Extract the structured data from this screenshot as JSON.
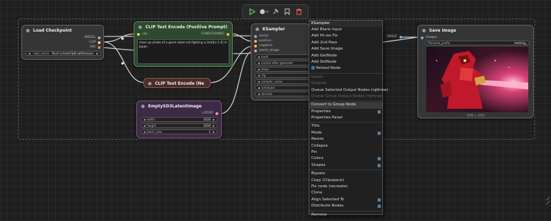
{
  "toolbar": {
    "items": [
      "run",
      "queue-options",
      "pin",
      "bookmark",
      "delete"
    ]
  },
  "nodes": {
    "load_checkpoint": {
      "title": "Load Checkpoint",
      "outputs": [
        "MODEL",
        "CLIP",
        "VAE"
      ],
      "ckpt_label": "ckpt_name",
      "ckpt_value": "flux1-schnell-fp8.safetensors"
    },
    "clip_pos": {
      "title": "CLIP Text Encode (Positive Prompt)",
      "input": "clip",
      "output": "CONDITIONING",
      "prompt": "close up photo of a giant robot red fighting a (hat)[x:1.4] in Japan"
    },
    "clip_neg": {
      "title": "CLIP Text Encode (Ne"
    },
    "ksampler": {
      "title": "KSampler",
      "inputs": [
        "model",
        "positive",
        "negative",
        "latent_image"
      ],
      "widgets": [
        "seed",
        "control after generate",
        "steps",
        "cfg",
        "sampler_name",
        "scheduler",
        "denoise"
      ]
    },
    "empty_latent": {
      "title": "EmptySD3LatentImage",
      "output": "LATENT",
      "widgets": [
        {
          "label": "width",
          "value": "1024"
        },
        {
          "label": "height",
          "value": "1024"
        },
        {
          "label": "batch_size",
          "value": "1"
        }
      ]
    },
    "save_image": {
      "title": "Save Image",
      "input": "images",
      "prefix_label": "filename_prefix",
      "prefix_value": "testimg_",
      "caption": "1008 × 1024",
      "vae_input_label": "IMAGE"
    }
  },
  "context_menu": {
    "title": "KSampler",
    "items": [
      {
        "label": "Add Blank Input",
        "state": "normal"
      },
      {
        "label": "Add Hi-res Fix",
        "state": "normal"
      },
      {
        "label": "Add 2nd Pass",
        "state": "normal"
      },
      {
        "label": "Add Save Image",
        "state": "normal"
      },
      {
        "label": "Add GetNode",
        "state": "normal"
      },
      {
        "label": "Add SetNode",
        "state": "normal"
      },
      {
        "label": "Reload Node",
        "state": "normal",
        "icon": "reload-icon"
      },
      {
        "label": "Inputs",
        "state": "disabled"
      },
      {
        "label": "Outputs",
        "state": "disabled"
      },
      {
        "label": "Queue Selected Output Nodes (rgthree)",
        "state": "normal"
      },
      {
        "label": "Queue Group Output Nodes (rgthree)",
        "state": "disabled"
      },
      {
        "label": "Convert to Group Node",
        "state": "highlight"
      },
      {
        "label": "Properties",
        "state": "normal",
        "submenu": true
      },
      {
        "label": "Properties Panel",
        "state": "normal"
      },
      {
        "label": "Title",
        "state": "normal"
      },
      {
        "label": "Mode",
        "state": "normal",
        "submenu": true
      },
      {
        "label": "Resize",
        "state": "normal"
      },
      {
        "label": "Collapse",
        "state": "normal"
      },
      {
        "label": "Pin",
        "state": "normal"
      },
      {
        "label": "Colors",
        "state": "normal",
        "submenu": true
      },
      {
        "label": "Shapes",
        "state": "normal",
        "submenu": true
      },
      {
        "label": "Bypass",
        "state": "normal"
      },
      {
        "label": "Copy (Clipspace)",
        "state": "normal"
      },
      {
        "label": "Fix node (recreate)",
        "state": "normal"
      },
      {
        "label": "Clone",
        "state": "normal"
      },
      {
        "label": "Align Selected To",
        "state": "normal",
        "submenu": true
      },
      {
        "label": "Distribute Nodes",
        "state": "normal",
        "submenu": true
      },
      {
        "label": "Remove",
        "state": "normal"
      }
    ]
  },
  "colors": {
    "model": "#b39ddb",
    "clip": "#f0d35a",
    "vae": "#ff6e6e",
    "conditioning": "#ffb74d",
    "latent": "#f48fb1",
    "image": "#64b5f6",
    "green_node": "#2e4a2e",
    "brown_node": "#4a2e2a",
    "purple_node": "#3d2a45"
  }
}
